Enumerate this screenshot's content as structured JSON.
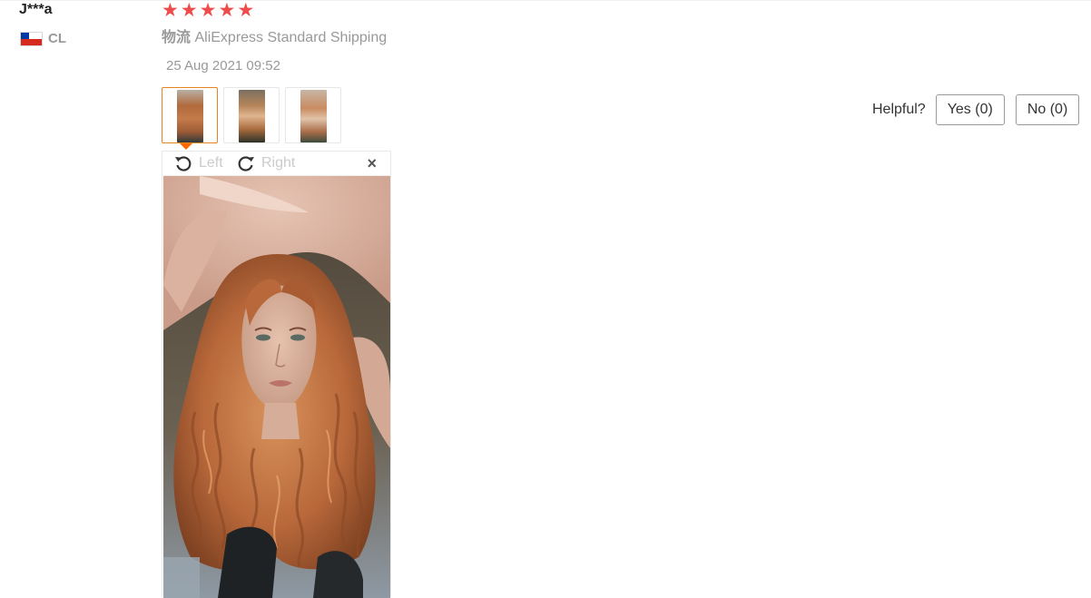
{
  "reviewer": {
    "name": "J***a",
    "country_code": "CL"
  },
  "rating": {
    "stars": 5,
    "max": 5
  },
  "shipping": {
    "label": "物流",
    "method": "AliExpress Standard Shipping"
  },
  "review_date": "25 Aug 2021 09:52",
  "viewer": {
    "rotate_left": "Left",
    "rotate_right": "Right",
    "close_symbol": "×"
  },
  "helpful": {
    "label": "Helpful?",
    "yes": "Yes (0)",
    "no": "No (0)"
  },
  "colors": {
    "star": "#f04b4b",
    "active_thumb_border": "#e6841f",
    "pointer": "#ff6a00"
  },
  "icons": [
    "chile-flag-icon",
    "star-icon",
    "rotate-left-icon",
    "rotate-right-icon",
    "close-icon"
  ]
}
